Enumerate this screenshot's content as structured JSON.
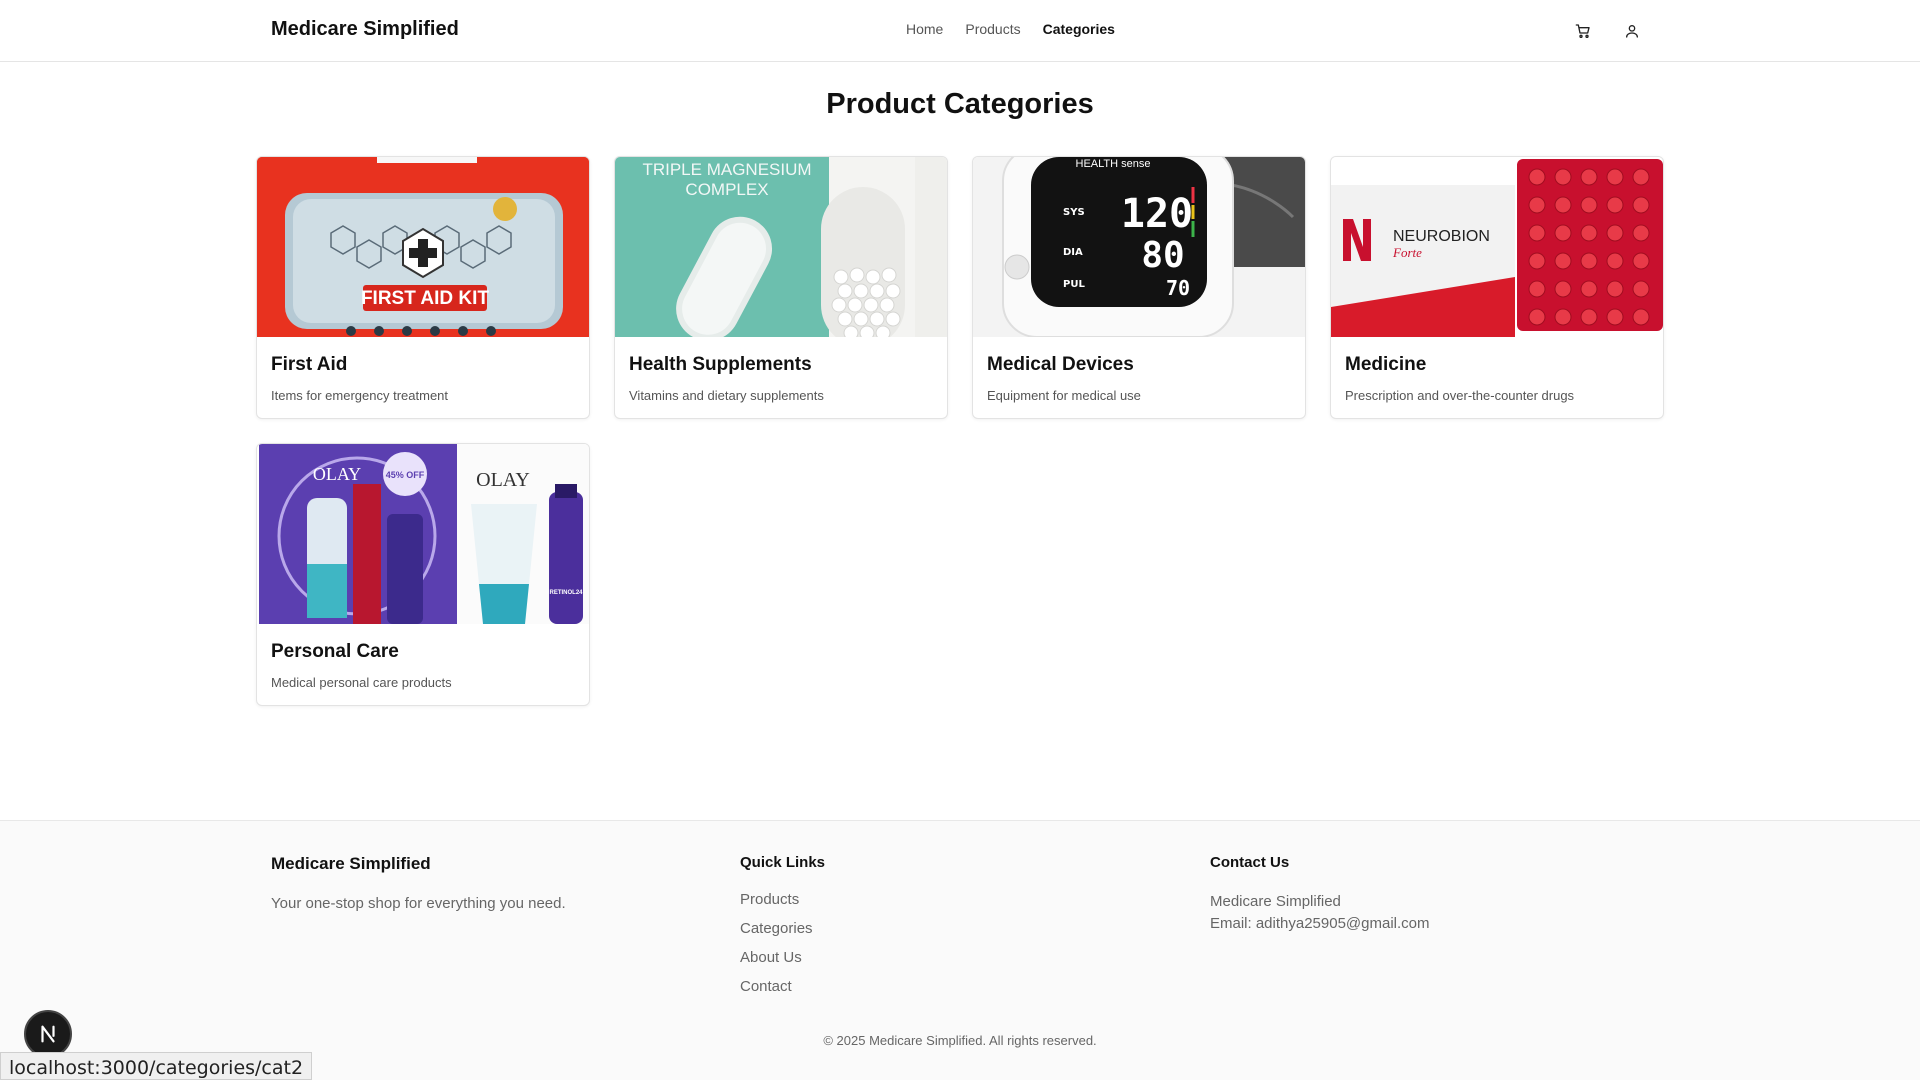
{
  "header": {
    "brand": "Medicare Simplified",
    "nav": [
      {
        "label": "Home"
      },
      {
        "label": "Products"
      },
      {
        "label": "Categories"
      }
    ],
    "icons": [
      "cart-icon",
      "user-icon"
    ]
  },
  "main": {
    "title": "Product Categories",
    "categories": [
      {
        "name": "First Aid",
        "description": "Items for emergency treatment"
      },
      {
        "name": "Health Supplements",
        "description": "Vitamins and dietary supplements"
      },
      {
        "name": "Medical Devices",
        "description": "Equipment for medical use"
      },
      {
        "name": "Medicine",
        "description": "Prescription and over-the-counter drugs"
      },
      {
        "name": "Personal Care",
        "description": "Medical personal care products"
      }
    ],
    "image_text": {
      "first_aid_label": "FIRST AID KIT",
      "supplement_label_1": "TRIPLE MAGNESIUM",
      "supplement_label_2": "COMPLEX",
      "monitor_sys": "120",
      "monitor_dia": "80",
      "monitor_pul": "70",
      "monitor_brand": "HEALTH sense",
      "medicine_brand": "NEUROBION",
      "medicine_sub": "Forte",
      "care_brand": "OLAY",
      "care_offer": "45% OFF",
      "care_product": "RETINOL24"
    }
  },
  "footer": {
    "brand": "Medicare Simplified",
    "tagline": "Your one-stop shop for everything you need.",
    "quick_links_heading": "Quick Links",
    "quick_links": [
      "Products",
      "Categories",
      "About Us",
      "Contact"
    ],
    "contact_heading": "Contact Us",
    "contact_name": "Medicare Simplified",
    "contact_email": "Email: adithya25905@gmail.com",
    "copyright": "© 2025 Medicare Simplified. All rights reserved."
  },
  "status_bar": {
    "url": "localhost:3000/categories/cat2"
  },
  "colors": {
    "accent": "#111111",
    "first_aid_red": "#e8321f",
    "supplement_teal": "#6cbfae",
    "medicine_red": "#d81b2a",
    "care_purple": "#5b3fb0"
  }
}
